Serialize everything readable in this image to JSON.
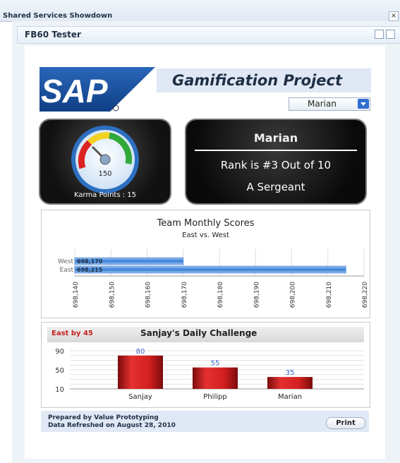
{
  "window": {
    "title": "Shared Services Showdown",
    "close_glyph": "×"
  },
  "panel": {
    "title": "FB60 Tester"
  },
  "header": {
    "logo_text": "SAP",
    "project_title": "Gamification Project",
    "selected_user": "Marian"
  },
  "karma": {
    "gauge_value": "150",
    "label": "Karma Points : 15"
  },
  "rank": {
    "name": "Marian",
    "rank_text": "Rank is #3 Out of 10",
    "rank_title": "A Sergeant"
  },
  "team_chart": {
    "title": "Team Monthly Scores",
    "subtitle": "East vs. West"
  },
  "challenge": {
    "leader_text": "East by 45",
    "title": "Sanjay's Daily Challenge"
  },
  "footer": {
    "prepared_by": "Prepared by Value Prototyping",
    "refreshed": "Data Refreshed on August 28, 2010",
    "print_label": "Print"
  },
  "colors": {
    "accent_blue": "#2f6fd0",
    "bar_red": "#d21f1f",
    "band": "#dfe8f4"
  },
  "icons": [
    "close-icon",
    "panel-menu-icon",
    "panel-minimize-icon",
    "dropdown-arrow-icon",
    "gauge-icon"
  ],
  "chart_data": [
    {
      "type": "bar",
      "orientation": "horizontal",
      "title": "Team Monthly Scores",
      "subtitle": "East vs. West",
      "categories": [
        "West",
        "East"
      ],
      "values": [
        698170,
        698215
      ],
      "data_labels": [
        "698,170",
        "698,215"
      ],
      "xlim": [
        698140,
        698220
      ],
      "x_ticks": [
        "698,140",
        "698,150",
        "698,160",
        "698,170",
        "698,180",
        "698,190",
        "698,200",
        "698,210",
        "698,220"
      ],
      "grid": true
    },
    {
      "type": "bar",
      "title": "Sanjay's Daily Challenge",
      "categories": [
        "Sanjay",
        "Philipp",
        "Marian"
      ],
      "values": [
        80,
        55,
        35
      ],
      "ylim": [
        10,
        90
      ],
      "y_ticks": [
        "10",
        "50",
        "90"
      ],
      "grid": true
    }
  ]
}
